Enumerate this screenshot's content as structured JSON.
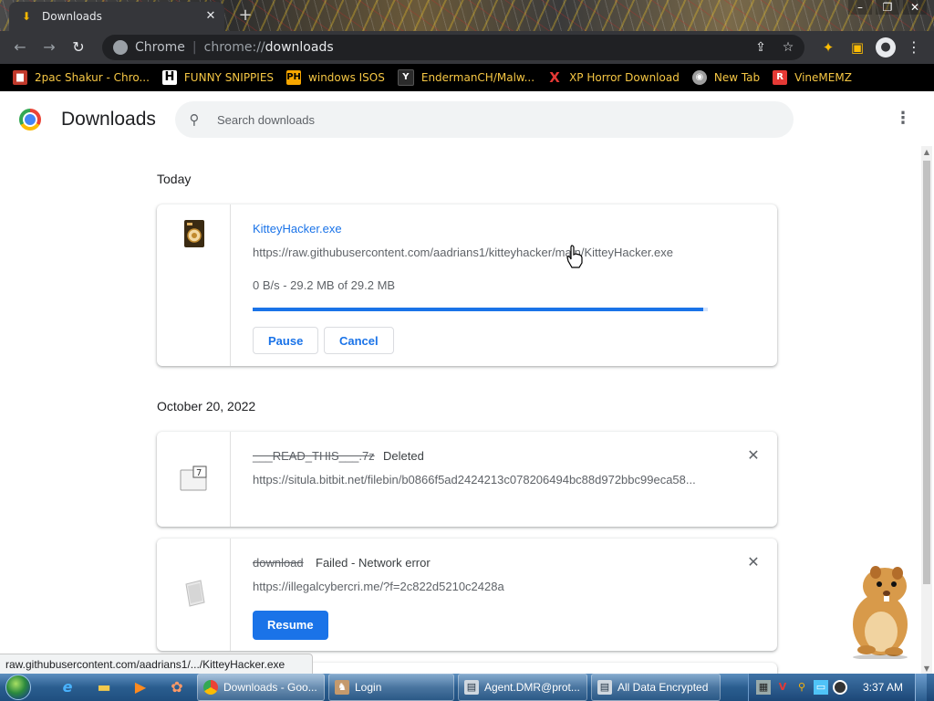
{
  "window": {
    "tab_title": "Downloads",
    "tab_close": "✕",
    "new_tab": "+",
    "controls": [
      "–",
      "❐",
      "✕"
    ]
  },
  "toolbar": {
    "back": "←",
    "forward": "→",
    "reload": "↻",
    "site_name": "Chrome",
    "separator": "|",
    "url_scheme": "chrome://",
    "url_host": "downloads",
    "share_icon": "⇪",
    "star_icon": "☆",
    "extension_icon": "✦",
    "sidepanel_icon": "▣",
    "profile_icon": "●",
    "menu_icon": "⋮"
  },
  "bookmarks": [
    {
      "label": "2pac Shakur - Chro...",
      "icon": "▆"
    },
    {
      "label": "FUNNY SNIPPIES",
      "icon": "H"
    },
    {
      "label": "windows ISOS",
      "icon": "PH"
    },
    {
      "label": "EndermanCH/Malw...",
      "icon": "Y"
    },
    {
      "label": "XP Horror Download",
      "icon": "X"
    },
    {
      "label": "New Tab",
      "icon": "◉"
    },
    {
      "label": "VineMEMZ",
      "icon": "R"
    }
  ],
  "page": {
    "title": "Downloads",
    "search_placeholder": "Search downloads",
    "more_menu": "⋮"
  },
  "sections": [
    {
      "date": "Today"
    },
    {
      "date": "October 20, 2022"
    }
  ],
  "downloads": [
    {
      "name": "KitteyHacker.exe",
      "url": "https://raw.githubusercontent.com/aadrians1/kitteyhacker/main/KitteyHacker.exe",
      "progress_text": "0 B/s - 29.2 MB of 29.2 MB",
      "progress_fraction": 0.99,
      "buttons": {
        "pause": "Pause",
        "cancel": "Cancel"
      }
    },
    {
      "name": "___READ_THIS___.7z",
      "status": "Deleted",
      "url": "https://situla.bitbit.net/filebin/b0866f5ad2424213c078206494bc88d972bbc99eca58...",
      "remove": "✕"
    },
    {
      "name": "download",
      "status": "Failed - Network error",
      "url": "https://illegalcybercri.me/?f=2c822d5210c2428a",
      "remove": "✕",
      "buttons": {
        "resume": "Resume"
      }
    }
  ],
  "status_bubble": "raw.githubusercontent.com/aadrians1/.../KitteyHacker.exe",
  "taskbar": {
    "tasks": [
      {
        "label": "Downloads - Goo...",
        "icon": ""
      },
      {
        "label": "Login",
        "icon": "♞"
      },
      {
        "label": "Agent.DMR@prot...",
        "icon": "▤"
      },
      {
        "label": "All Data Encrypted",
        "icon": "▤"
      }
    ],
    "quick_launch": [
      "e",
      "▬",
      "▶",
      "✿"
    ],
    "tray": [
      "▦",
      "V",
      "⚲",
      "▭",
      ""
    ],
    "clock": "3:37 AM"
  }
}
